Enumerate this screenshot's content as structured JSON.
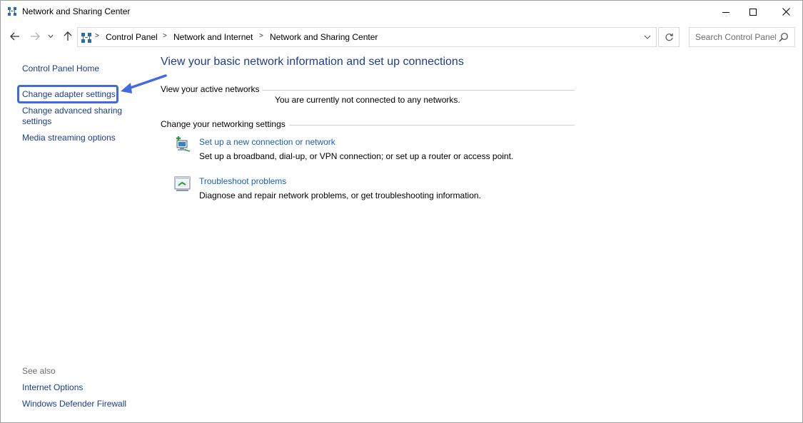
{
  "window": {
    "title": "Network and Sharing Center"
  },
  "address_bar": {
    "breadcrumbs": [
      "Control Panel",
      "Network and Internet",
      "Network and Sharing Center"
    ],
    "separator": ">"
  },
  "search": {
    "placeholder": "Search Control Panel"
  },
  "sidebar": {
    "links": [
      {
        "label": "Control Panel Home"
      },
      {
        "label": "Change adapter settings"
      },
      {
        "label": "Change advanced sharing",
        "label2": "settings"
      },
      {
        "label": "Media streaming options"
      }
    ],
    "see_also_label": "See also",
    "see_also_links": [
      {
        "label": "Internet Options"
      },
      {
        "label": "Windows Defender Firewall"
      }
    ]
  },
  "main": {
    "title": "View your basic network information and set up connections",
    "active_networks_heading": "View your active networks",
    "not_connected_text": "You are currently not connected to any networks.",
    "settings_heading": "Change your networking settings",
    "tasks": [
      {
        "link": "Set up a new connection or network",
        "description": "Set up a broadband, dial-up, or VPN connection; or set up a router or access point.",
        "icon": "network-setup-icon"
      },
      {
        "link": "Troubleshoot problems",
        "description": "Diagnose and repair network problems, or get troubleshooting information.",
        "icon": "troubleshoot-icon"
      }
    ]
  },
  "colors": {
    "link": "#1a5fb4",
    "title": "#1e3d8c",
    "highlight": "#4169e1"
  }
}
